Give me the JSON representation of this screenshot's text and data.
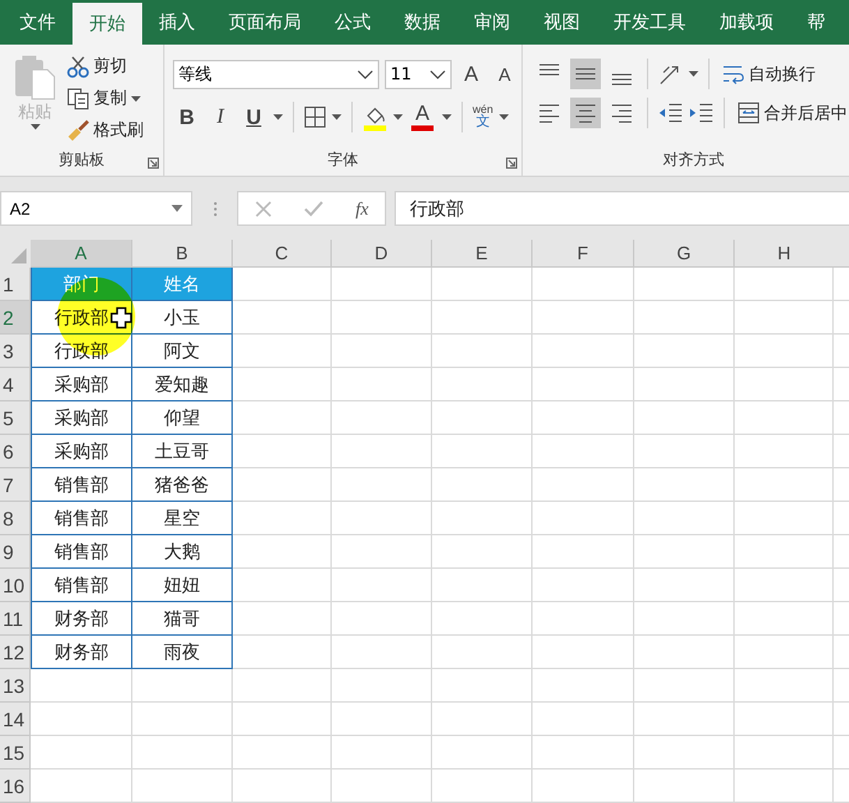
{
  "menu_tabs": [
    {
      "label": "文件",
      "selected": false
    },
    {
      "label": "开始",
      "selected": true
    },
    {
      "label": "插入",
      "selected": false
    },
    {
      "label": "页面布局",
      "selected": false
    },
    {
      "label": "公式",
      "selected": false
    },
    {
      "label": "数据",
      "selected": false
    },
    {
      "label": "审阅",
      "selected": false
    },
    {
      "label": "视图",
      "selected": false
    },
    {
      "label": "开发工具",
      "selected": false
    },
    {
      "label": "加载项",
      "selected": false
    },
    {
      "label": "帮",
      "selected": false
    }
  ],
  "ribbon": {
    "clipboard": {
      "paste": {
        "label": "粘贴",
        "disabled": true
      },
      "cut": "剪切",
      "copy": "复制",
      "format_painter": "格式刷",
      "title": "剪贴板"
    },
    "font": {
      "font_name": "等线",
      "font_size": "11",
      "grow": "A",
      "shrink": "A",
      "bold": "B",
      "italic": "I",
      "underline": "U",
      "font_color_letter": "A",
      "phonetic": {
        "top": "wén",
        "bottom": "文"
      },
      "title": "字体"
    },
    "alignment": {
      "vertical": [
        {
          "kind": "top",
          "selected": false
        },
        {
          "kind": "middle",
          "selected": true
        },
        {
          "kind": "bottom",
          "selected": false
        }
      ],
      "horizontal": [
        {
          "kind": "left",
          "selected": false
        },
        {
          "kind": "center",
          "selected": true
        },
        {
          "kind": "right",
          "selected": false
        }
      ],
      "wrap_text": "自动换行",
      "merge_center": "合并后居中",
      "title": "对齐方式"
    }
  },
  "formula_bar": {
    "name_box": "A2",
    "fx": "fx",
    "formula": "行政部"
  },
  "sheet": {
    "columns": [
      "A",
      "B",
      "C",
      "D",
      "E",
      "F",
      "G",
      "H"
    ],
    "row_numbers": [
      "1",
      "2",
      "3",
      "4",
      "5",
      "6",
      "7",
      "8",
      "9",
      "10",
      "11",
      "12",
      "13",
      "14",
      "15",
      "16"
    ],
    "header": [
      "部门",
      "姓名"
    ],
    "rows": [
      [
        "行政部",
        "小玉"
      ],
      [
        "行政部",
        "阿文"
      ],
      [
        "采购部",
        "爱知趣"
      ],
      [
        "采购部",
        "仰望"
      ],
      [
        "采购部",
        "土豆哥"
      ],
      [
        "销售部",
        "猪爸爸"
      ],
      [
        "销售部",
        "星空"
      ],
      [
        "销售部",
        "大鹅"
      ],
      [
        "销售部",
        "妞妞"
      ],
      [
        "财务部",
        "猫哥"
      ],
      [
        "财务部",
        "雨夜"
      ]
    ]
  }
}
